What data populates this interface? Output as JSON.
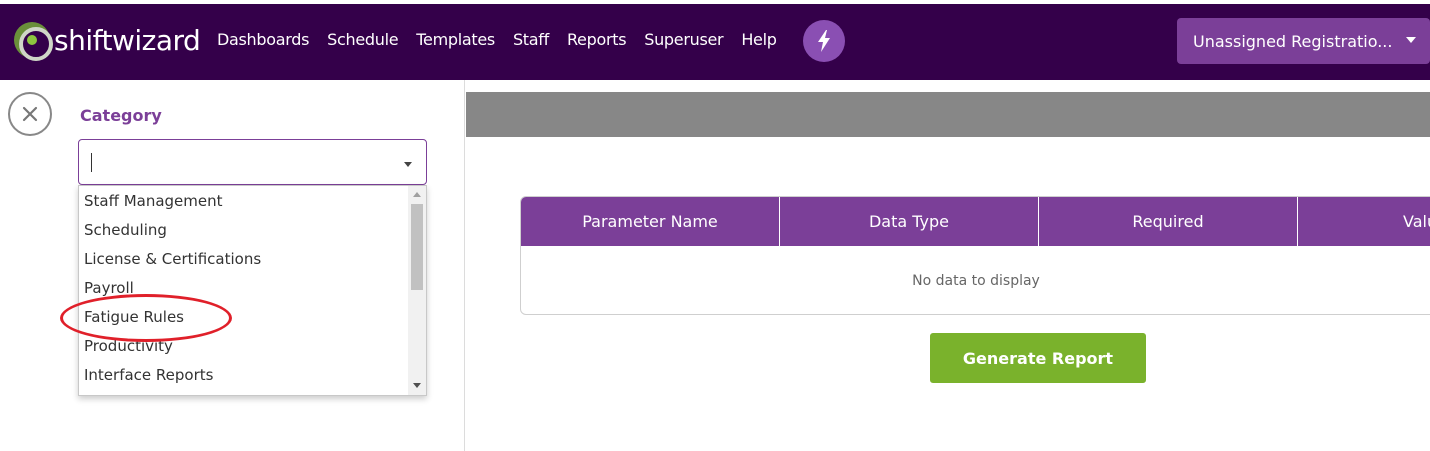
{
  "header": {
    "logo_text": "shiftwizard",
    "nav": [
      "Dashboards",
      "Schedule",
      "Templates",
      "Staff",
      "Reports",
      "Superuser",
      "Help"
    ],
    "account_dropdown": "Unassigned Registratio..."
  },
  "sidebar": {
    "category_label": "Category",
    "category_value": "",
    "options": [
      "Staff Management",
      "Scheduling",
      "License & Certifications",
      "Payroll",
      "Fatigue Rules",
      "Productivity",
      "Interface Reports"
    ]
  },
  "parameters_table": {
    "columns": [
      "Parameter Name",
      "Data Type",
      "Required",
      "Valu"
    ],
    "empty_message": "No data to display"
  },
  "actions": {
    "generate_label": "Generate Report"
  },
  "colors": {
    "header_bg": "#34004a",
    "accent": "#7b3f98",
    "generate_button": "#7ab22c",
    "annotation_circle": "#e0202a"
  },
  "icons": {
    "logo": "shiftwizard-logo-icon",
    "bolt": "lightning-bolt-icon",
    "close": "close-icon"
  }
}
